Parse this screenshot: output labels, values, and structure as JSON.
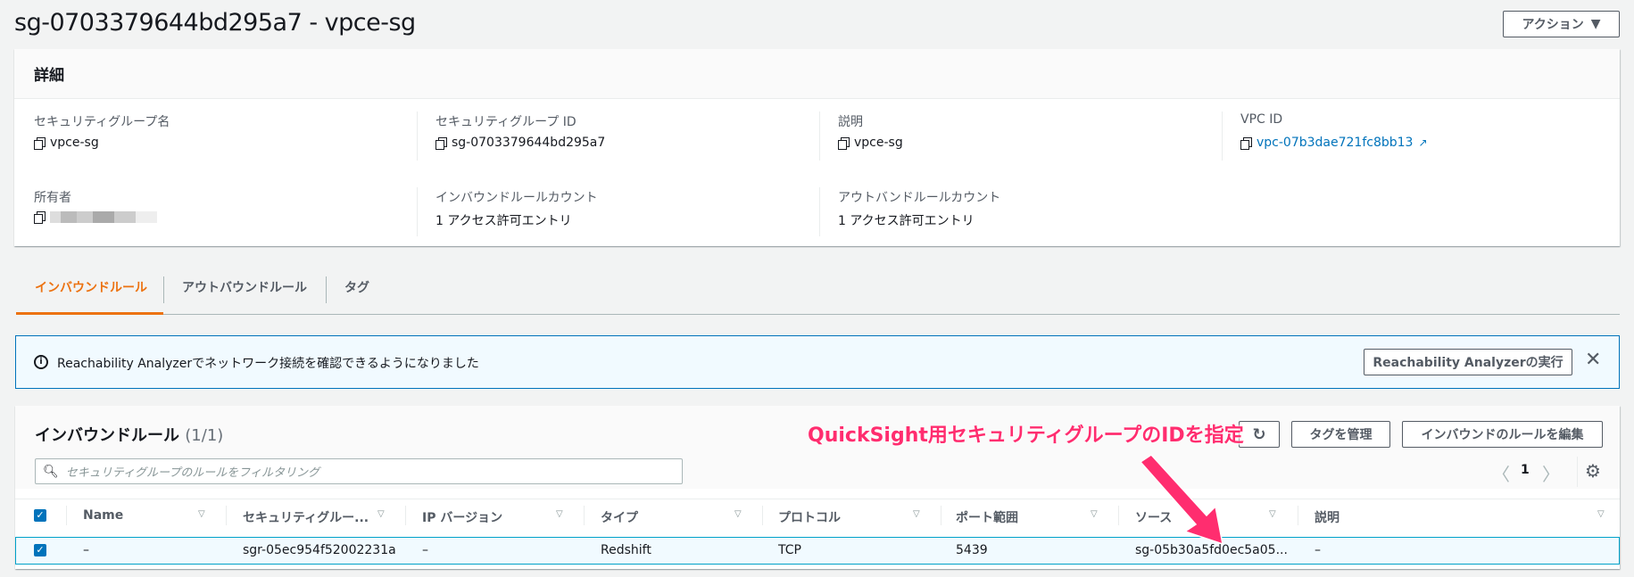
{
  "page": {
    "title": "sg-0703379644bd295a7 - vpce-sg",
    "actions_label": "アクション",
    "actions_icon": "caret-down-icon"
  },
  "details": {
    "header": "詳細",
    "fields": [
      {
        "label": "セキュリティグループ名",
        "value": "vpce-sg"
      },
      {
        "label": "セキュリティグループ ID",
        "value": "sg-0703379644bd295a7"
      },
      {
        "label": "説明",
        "value": "vpce-sg"
      },
      {
        "label": "VPC ID",
        "value": "vpc-07b3dae721fc8bb13"
      },
      {
        "label": "所有者",
        "value": ""
      },
      {
        "label": "インバウンドルールカウント",
        "value": "1 アクセス許可エントリ"
      },
      {
        "label": "アウトバンドルールカウント",
        "value": "1 アクセス許可エントリ"
      }
    ]
  },
  "tabs": [
    {
      "label": "インバウンドルール"
    },
    {
      "label": "アウトバウンドルール"
    },
    {
      "label": "タグ"
    }
  ],
  "banner": {
    "text": "Reachability Analyzerでネットワーク接続を確認できるようになりました",
    "button": "Reachability Analyzerの実行"
  },
  "rules": {
    "title": "インバウンドルール",
    "count": "(1/1)",
    "manage_tags": "タグを管理",
    "edit": "インバウンドのルールを編集",
    "filter_placeholder": "セキュリティグループのルールをフィルタリング",
    "page": "1",
    "columns": [
      "Name",
      "セキュリティグルー...",
      "IP バージョン",
      "タイプ",
      "プロトコル",
      "ポート範囲",
      "ソース",
      "説明"
    ],
    "rows": [
      [
        "–",
        "sgr-05ec954f52002231a",
        "–",
        "Redshift",
        "TCP",
        "5439",
        "sg-05b30a5fd0ec5a05...",
        "–"
      ]
    ]
  },
  "annotation": {
    "text": "QuickSight用セキュリティグループのIDを指定",
    "color": "#ff2d6f"
  }
}
